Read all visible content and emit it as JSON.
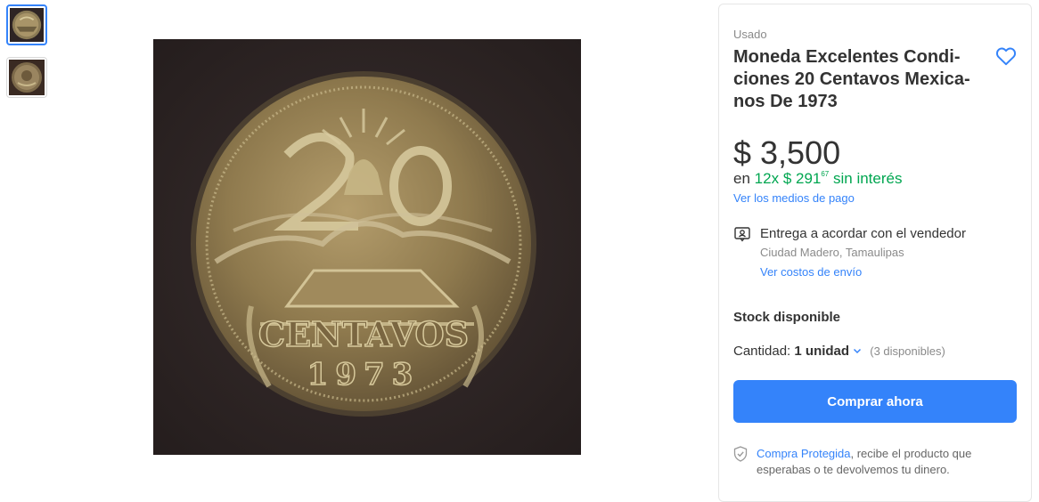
{
  "gallery": {
    "thumbnails": [
      {
        "label": "thumbnail-1",
        "selected": true
      },
      {
        "label": "thumbnail-2",
        "selected": false
      }
    ]
  },
  "product": {
    "condition": "Usado",
    "title_lines": [
      "Moneda Excelentes Condi-",
      "ciones 20 Centavos Mexica-",
      "nos De 1973"
    ],
    "price": "$ 3,500",
    "installments": {
      "prefix": "en",
      "count": "12x",
      "amount": "$ 291",
      "cents": "67",
      "suffix": "sin interés"
    },
    "payment_methods_link": "Ver los medios de pago"
  },
  "delivery": {
    "title": "Entrega a acordar con el vendedor",
    "location": "Ciudad Madero, Tamaulipas",
    "shipping_link": "Ver costos de envío"
  },
  "stock": {
    "title": "Stock disponible",
    "quantity_label": "Cantidad:",
    "quantity_value": "1 unidad",
    "available": "(3 disponibles)"
  },
  "actions": {
    "buy_now": "Comprar ahora"
  },
  "protection": {
    "link": "Compra Protegida",
    "text": ", recibe el producto que esperabas o te devolvemos tu dinero."
  },
  "coin_inscriptions": {
    "denomination": "20",
    "word": "CENTAVOS",
    "year": "1973"
  },
  "colors": {
    "accent": "#3483fa",
    "green": "#00a650",
    "text": "#333333",
    "muted": "#8a8a8a"
  },
  "icons": [
    "heart-icon",
    "delivery-person-icon",
    "chevron-down-icon",
    "shield-check-icon"
  ]
}
